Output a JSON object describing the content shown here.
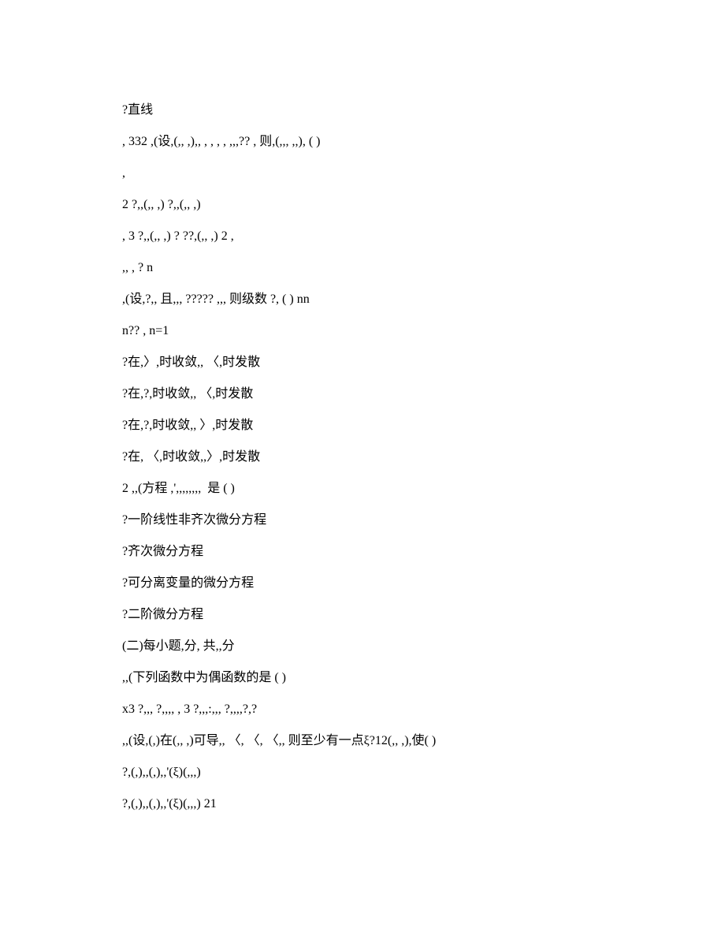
{
  "lines": [
    "?直线",
    ", 332 ,(设,(,, ,),, , , , , ,,,?? , 则,(,,, ,,), ( )",
    ",",
    "2 ?,,(,, ,) ?,,(,, ,)",
    ", 3 ?,,(,, ,) ? ??,(,, ,) 2 ,",
    ",, , ? n",
    ",(设,?,, 且,,, ????? ,,, 则级数 ?, ( ) nn",
    "n?? , n=1",
    "?在,〉,时收敛,, 〈,时发散",
    "?在,?,时收敛,, 〈,时发散",
    "?在,?,时收敛,, 〉,时发散",
    "?在, 〈,时收敛,,〉,时发散",
    "2 ,,(方程 ,',,,,,,,,  是 ( )",
    "?一阶线性非齐次微分方程",
    "?齐次微分方程",
    "?可分离变量的微分方程",
    "?二阶微分方程",
    "(二)每小题,分, 共,,分",
    ",,(下列函数中为偶函数的是 ( )",
    "x3 ?,,, ?,,,, , 3 ?,,,:,,, ?,,,,?,?",
    ",,(设,(,)在(,, ,)可导,, 〈, 〈, 〈,, 则至少有一点ξ?12(,, ,),使( )",
    "?,(,),,(,),,'(ξ)(,,,)",
    "?,(,),,(,),,'(ξ)(,,,) 21"
  ]
}
